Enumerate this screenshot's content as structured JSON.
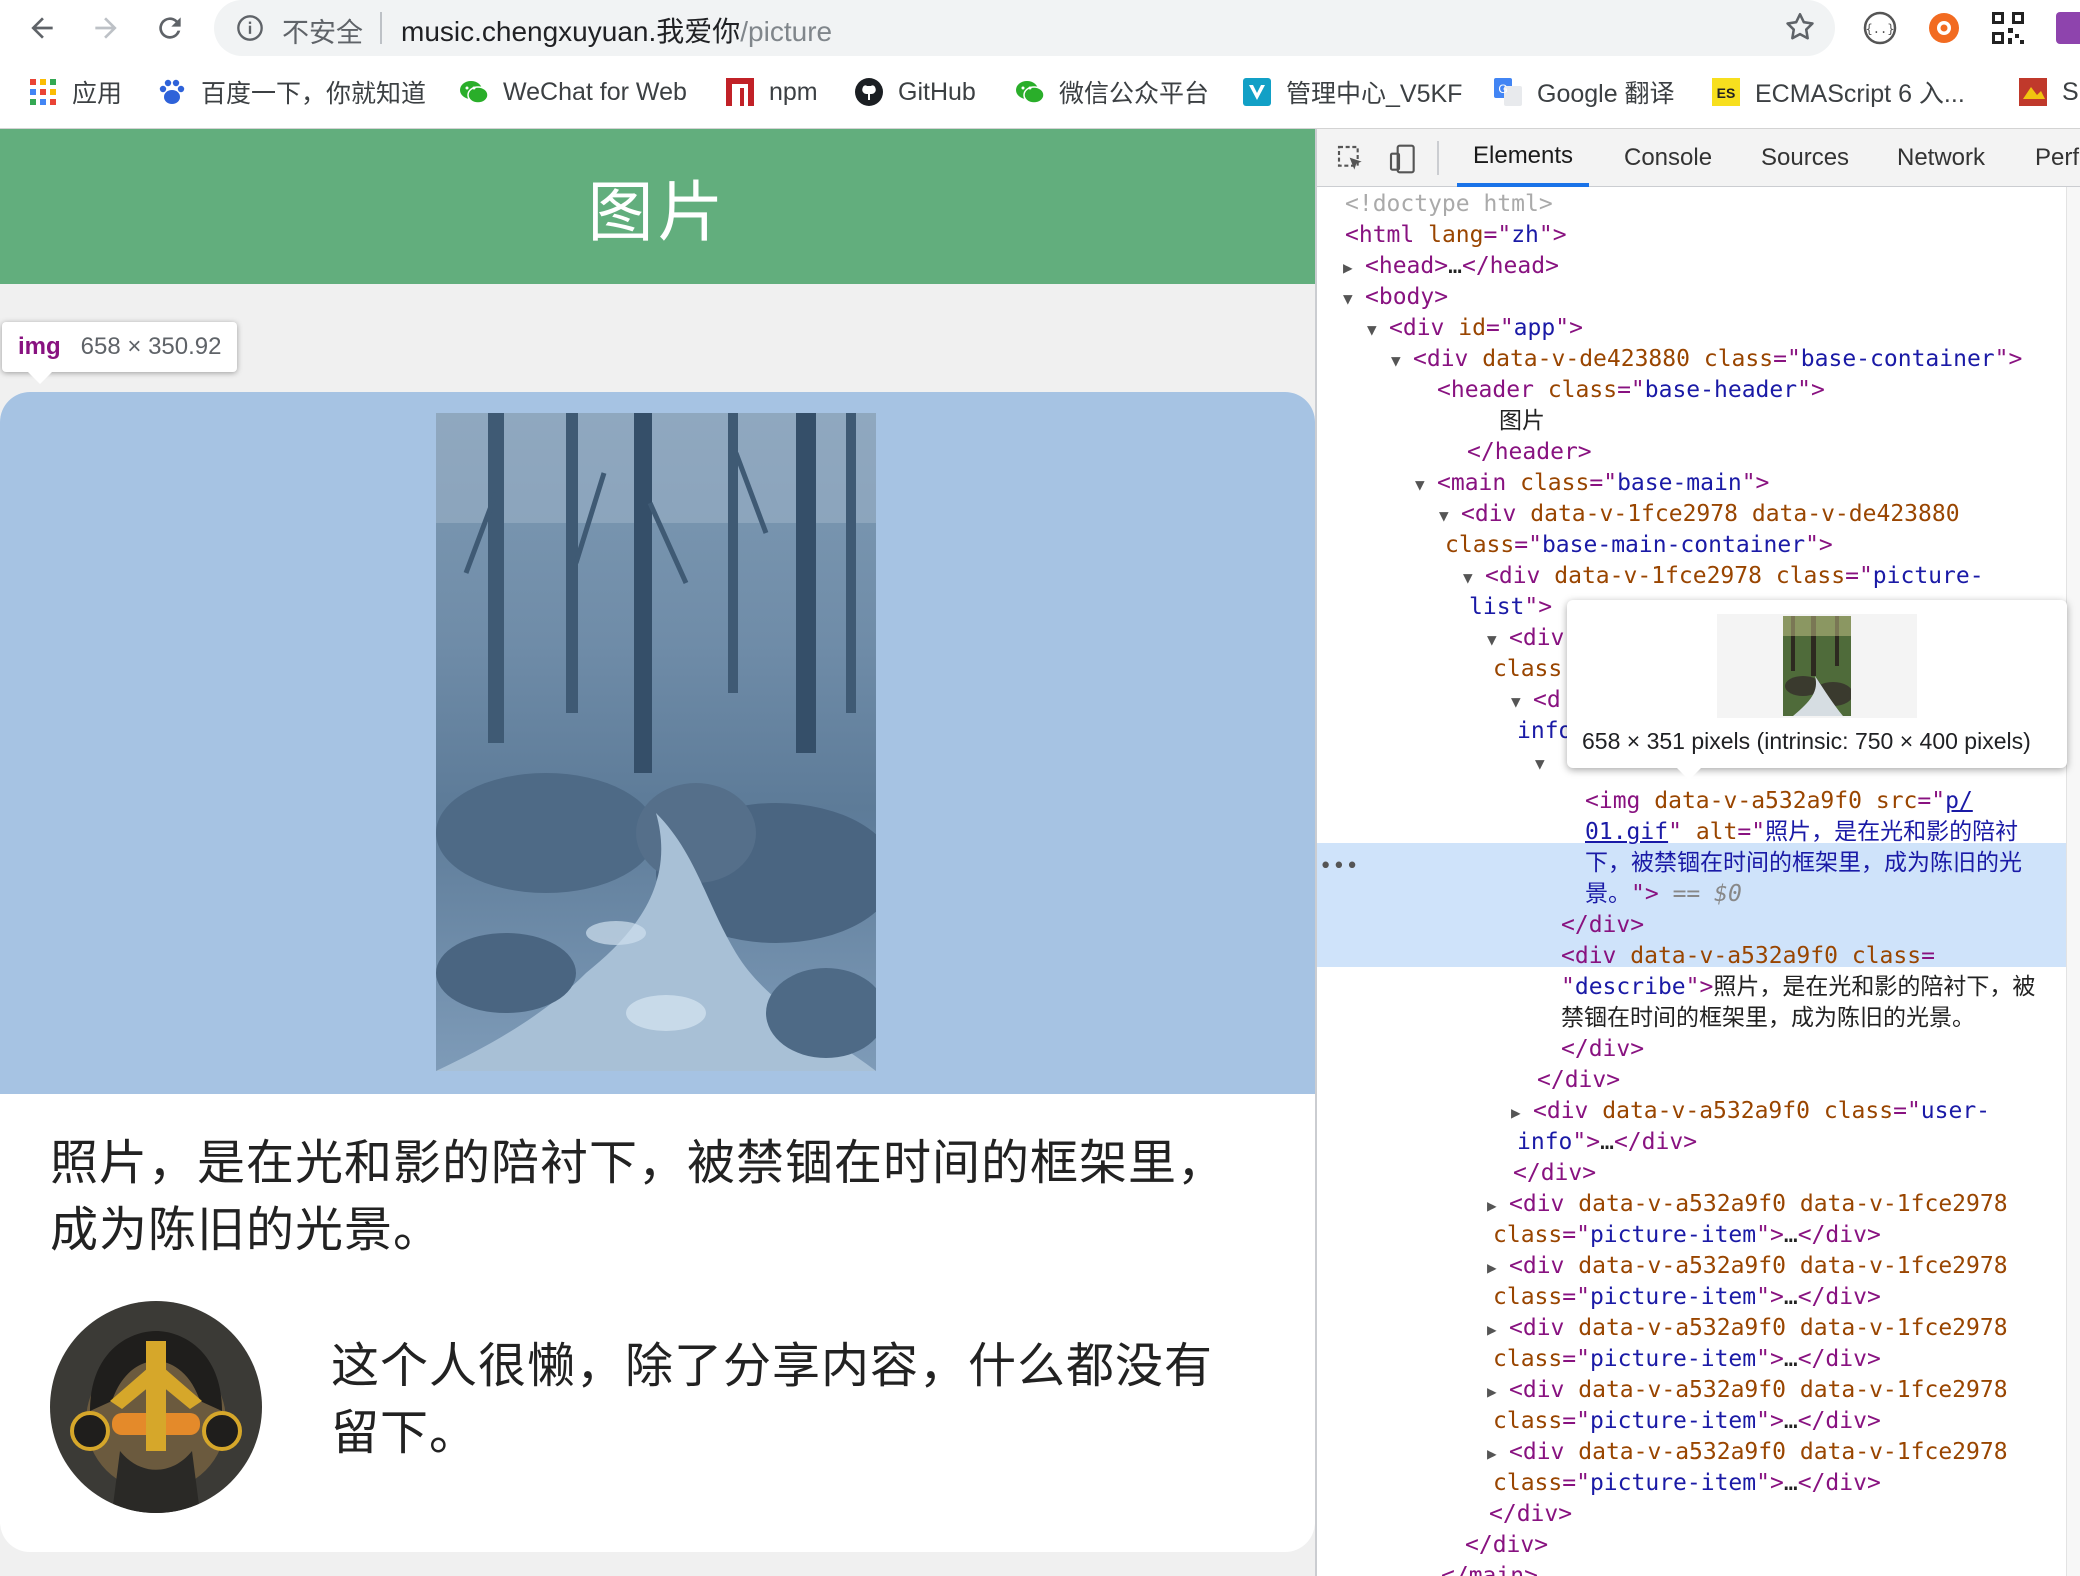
{
  "browser": {
    "omnibox": {
      "security_label": "不安全",
      "url_host": "music.chengxuyuan.我爱你",
      "url_path": "/picture"
    },
    "bookmarks": [
      {
        "label": "应用",
        "icon": "apps-grid-icon"
      },
      {
        "label": "百度一下，你就知道",
        "icon": "baidu-paw-icon"
      },
      {
        "label": "WeChat for Web",
        "icon": "wechat-icon"
      },
      {
        "label": "npm",
        "icon": "npm-icon"
      },
      {
        "label": "GitHub",
        "icon": "github-icon"
      },
      {
        "label": "微信公众平台",
        "icon": "wechat-icon"
      },
      {
        "label": "管理中心_V5KF",
        "icon": "v5kf-icon"
      },
      {
        "label": "Google 翻译",
        "icon": "google-translate-icon"
      },
      {
        "label": "ECMAScript 6 入...",
        "icon": "es-icon"
      },
      {
        "label": "S",
        "icon": "bookmark-icon"
      }
    ],
    "colors": {
      "header_green": "#62ae7d",
      "image_overlay": "#a6c3e3",
      "devtools_accent": "#1a73e8"
    }
  },
  "page": {
    "header_title": "图片",
    "inspect_tooltip": {
      "tag": "img",
      "size": "658 × 350.92"
    },
    "picture": {
      "describe": "照片，是在光和影的陪衬下，被禁锢在时间的框架里，成为陈旧的光景。",
      "user_desc": "这个人很懒，除了分享内容，什么都没有留下。"
    }
  },
  "devtools": {
    "tabs": [
      "Elements",
      "Console",
      "Sources",
      "Network",
      "Perfo"
    ],
    "active_tab": "Elements",
    "image_popover": "658 × 351 pixels (intrinsic: 750 × 400 pixels)",
    "selected_marker": "== $0",
    "dom": {
      "doctype": "<!doctype html>",
      "html_tag": "html",
      "lang_attr": "lang",
      "lang_val": "zh",
      "head": "head",
      "body": "body",
      "div": "div",
      "id_attr": "id",
      "app": "app",
      "class_attr": "class",
      "v_de": "data-v-de423880",
      "v_1f": "data-v-1fce2978",
      "v_a5": "data-v-a532a9f0",
      "base_container": "base-container",
      "header": "header",
      "base_header": "base-header",
      "header_text": "图片",
      "main": "main",
      "base_main": "base-main",
      "base_main_container": "base-main-container",
      "picture_list_1": "picture-",
      "picture_list_2": "list",
      "div_partial": "<div",
      "class_partial": "class",
      "d_partial": "<d",
      "info_partial": "info",
      "img_tag": "img",
      "src_attr": "src",
      "src_val_1": "p/",
      "src_val_2": "01.gif",
      "alt_attr": "alt",
      "alt_1": "照片，是在光和影的陪衬",
      "alt_2": "下，被禁锢在时间的框架里，成为陈旧的光",
      "alt_3": "景。",
      "describe_class": "describe",
      "describe_text_1": "照片，是在光和影的陪衬下，被",
      "describe_text_2": "禁锢在时间的框架里，成为陈旧的光景。",
      "user_info_1": "user-",
      "user_info_2": "info",
      "picture_item": "picture-item",
      "ellipsis": "…",
      "collapsed_marker": "…"
    }
  }
}
